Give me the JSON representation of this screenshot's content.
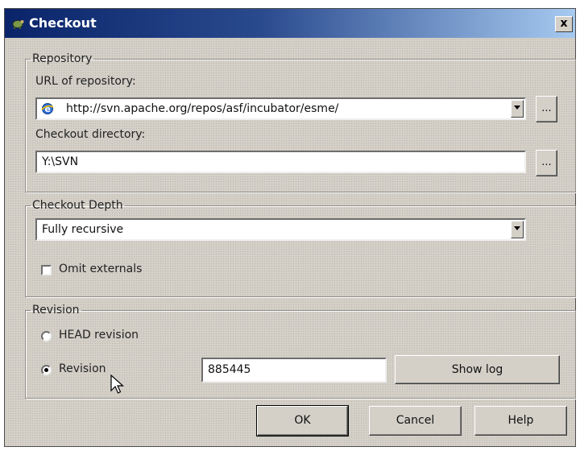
{
  "window": {
    "title": "Checkout",
    "close_label": "x"
  },
  "repository": {
    "legend": "Repository",
    "url_label": "URL of repository:",
    "url_value": "http://svn.apache.org/repos/asf/incubator/esme/",
    "checkout_dir_label": "Checkout directory:",
    "checkout_dir_value": "Y:\\SVN",
    "browse_label": "..."
  },
  "depth": {
    "legend": "Checkout Depth",
    "selected": "Fully recursive",
    "omit_externals_label": "Omit externals",
    "omit_externals_checked": false
  },
  "revision": {
    "legend": "Revision",
    "head_label": "HEAD revision",
    "revision_label": "Revision",
    "selected": "revision",
    "revision_value": "885445",
    "show_log_label": "Show log"
  },
  "buttons": {
    "ok": "OK",
    "cancel": "Cancel",
    "help": "Help"
  },
  "icons": {
    "app": "tortoise-icon",
    "url_field": "ie-globe-icon",
    "cursor": "mouse-pointer-icon"
  },
  "colors": {
    "title_start": "#0a246a",
    "title_end": "#a6caf0",
    "dialog_bg": "#d4d0c8"
  }
}
